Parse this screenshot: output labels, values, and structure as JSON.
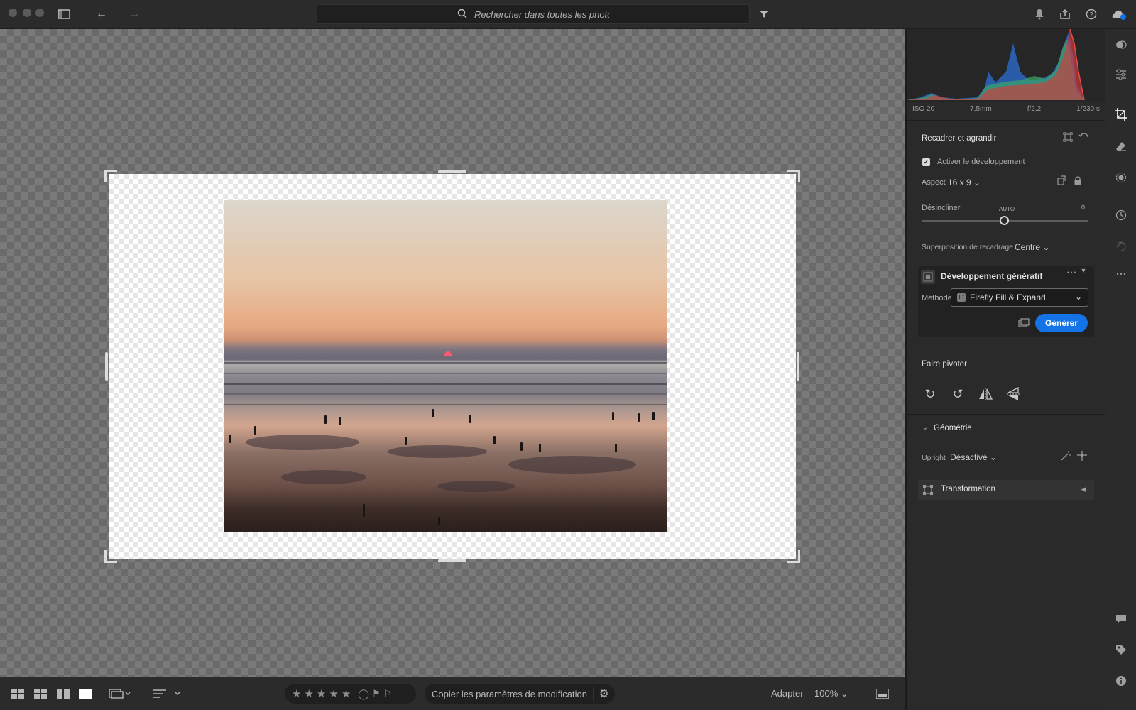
{
  "toolbar": {
    "search_placeholder": "Rechercher dans toutes les photos",
    "icons": [
      "sidebar-icon",
      "back-arrow-icon",
      "forward-arrow-icon",
      "search-icon",
      "filter-icon",
      "bell-icon",
      "share-icon",
      "help-icon",
      "cloud-sync-icon"
    ]
  },
  "panel": {
    "histogram": {
      "iso": "ISO 20",
      "focal": "7,5mm",
      "aperture": "f/2,2",
      "shutter": "1/230 s"
    },
    "crop": {
      "title": "Recadrer et agrandir",
      "expand_label": "Activer le développement",
      "expand_checked": true,
      "aspect_label": "Aspect",
      "aspect_value": "16 x 9",
      "straighten_label": "Désincliner",
      "straighten_auto": "AUTO",
      "straighten_value": "0",
      "straighten_level": 0.5,
      "overlay_label": "Superposition de recadrage",
      "overlay_value": "Centre"
    },
    "generative": {
      "title": "Développement génératif",
      "method_label": "Méthode",
      "method_value": "Firefly Fill & Expand",
      "generate_label": "Générer"
    },
    "rotate": {
      "title": "Faire pivoter"
    },
    "geometry": {
      "title": "Géométrie",
      "upright_label": "Upright",
      "upright_value": "Désactivé",
      "transform_label": "Transformation"
    }
  },
  "bottombar": {
    "copy_label": "Copier les paramètres de modification",
    "fit_label": "Adapter",
    "zoom_value": "100%"
  },
  "colors": {
    "accent": "#1473e6",
    "panel_bg": "#2a2a2a",
    "canvas_bg": "#7a7a7a"
  }
}
